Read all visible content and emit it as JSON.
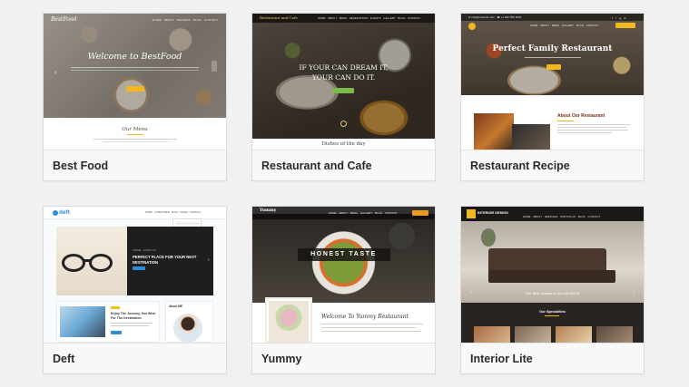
{
  "themes": [
    {
      "name": "Best Food",
      "preview": {
        "logo": "BestFood",
        "hero_title": "Welcome to BestFood",
        "section_title": "Our Menu"
      }
    },
    {
      "name": "Restaurant and Cafe",
      "preview": {
        "logo": "Restaurant and Cafe",
        "hero_line1": "IF YOUR CAN DREAM IT,",
        "hero_line2": "YOUR CAN DO IT.",
        "section_title": "Dishes of the day"
      }
    },
    {
      "name": "Restaurant Recipe",
      "preview": {
        "hero_title": "Perfect Family Restaurant",
        "section_title": "About Our Restaurant"
      }
    },
    {
      "name": "Deft",
      "preview": {
        "logo": "deft",
        "hero_title_line1": "PERFECT PLACE FOR YOUR NEXT",
        "hero_title_line2": "DESTINATION",
        "post_title_line1": "Enjoy The Journey, Not Wish",
        "post_title_line2": "For The Destination",
        "widget_title": "About ME"
      }
    },
    {
      "name": "Yummy",
      "preview": {
        "logo": "Yummy",
        "hero_title": "HONEST TASTE",
        "welcome": "Welcome To Yummy Restaurant"
      }
    },
    {
      "name": "Interior Lite",
      "preview": {
        "logo": "INTERIOR DESIGN",
        "tagline": "The Best Choice is Our DIVISION",
        "section_title": "Our Specialities"
      }
    }
  ],
  "colors": {
    "page_bg": "#f1f1f1",
    "card_border": "#dcdcdc",
    "accent_yellow": "#f2b91f",
    "accent_green": "#7dbb48",
    "accent_orange": "#e99c25",
    "accent_blue": "#2a8fd8",
    "deft_dark": "#1e1e1e"
  }
}
